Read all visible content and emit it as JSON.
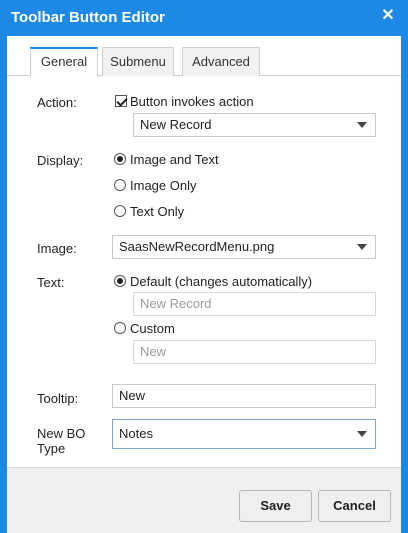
{
  "window": {
    "title": "Toolbar Button Editor",
    "close_icon": "close-icon"
  },
  "tabs": [
    {
      "label": "General",
      "active": true
    },
    {
      "label": "Submenu",
      "active": false
    },
    {
      "label": "Advanced",
      "active": false
    }
  ],
  "action": {
    "label": "Action:",
    "checkbox_label": "Button invokes action",
    "checked": true,
    "select_value": "New Record"
  },
  "display": {
    "label": "Display:",
    "options": [
      "Image and Text",
      "Image Only",
      "Text Only"
    ],
    "selected": "Image and Text"
  },
  "image": {
    "label": "Image:",
    "value": "SaasNewRecordMenu.png"
  },
  "text": {
    "label": "Text:",
    "default_label": "Default (changes automatically)",
    "default_value": "New Record",
    "custom_label": "Custom",
    "custom_value": "New",
    "selected": "Default"
  },
  "tooltip": {
    "label": "Tooltip:",
    "value": "New"
  },
  "bo_type": {
    "label_line1": "New BO",
    "label_line2": "Type",
    "value": "Notes"
  },
  "buttons": {
    "save": "Save",
    "cancel": "Cancel"
  },
  "colors": {
    "accent": "#1e88e5"
  }
}
